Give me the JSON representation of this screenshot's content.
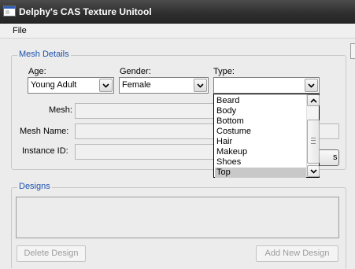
{
  "window": {
    "title": "Delphy's CAS Texture Unitool"
  },
  "menu": {
    "file": "File"
  },
  "mesh_details": {
    "caption": "Mesh Details",
    "age": {
      "label": "Age:",
      "value": "Young Adult"
    },
    "gender": {
      "label": "Gender:",
      "value": "Female"
    },
    "type": {
      "label": "Type:",
      "value": ""
    },
    "mesh_label": "Mesh:",
    "mesh_name_label": "Mesh Name:",
    "instance_id_label": "Instance ID:"
  },
  "type_dropdown": {
    "options": [
      "Beard",
      "Body",
      "Bottom",
      "Costume",
      "Hair",
      "Makeup",
      "Shoes",
      "Top"
    ],
    "highlighted": "Top"
  },
  "designs": {
    "caption": "Designs",
    "delete_button": "Delete Design",
    "add_button": "Add New Design"
  },
  "icons": {
    "app": "window-app-icon",
    "combo_arrow": "chevron-down-icon",
    "scroll_up": "chevron-up-icon",
    "scroll_down": "chevron-down-icon"
  },
  "colors": {
    "title_bar": "#2e2e2e",
    "group_caption": "#1c50b0",
    "window_bg": "#ececec",
    "selected_item": "#c8c8c8"
  }
}
